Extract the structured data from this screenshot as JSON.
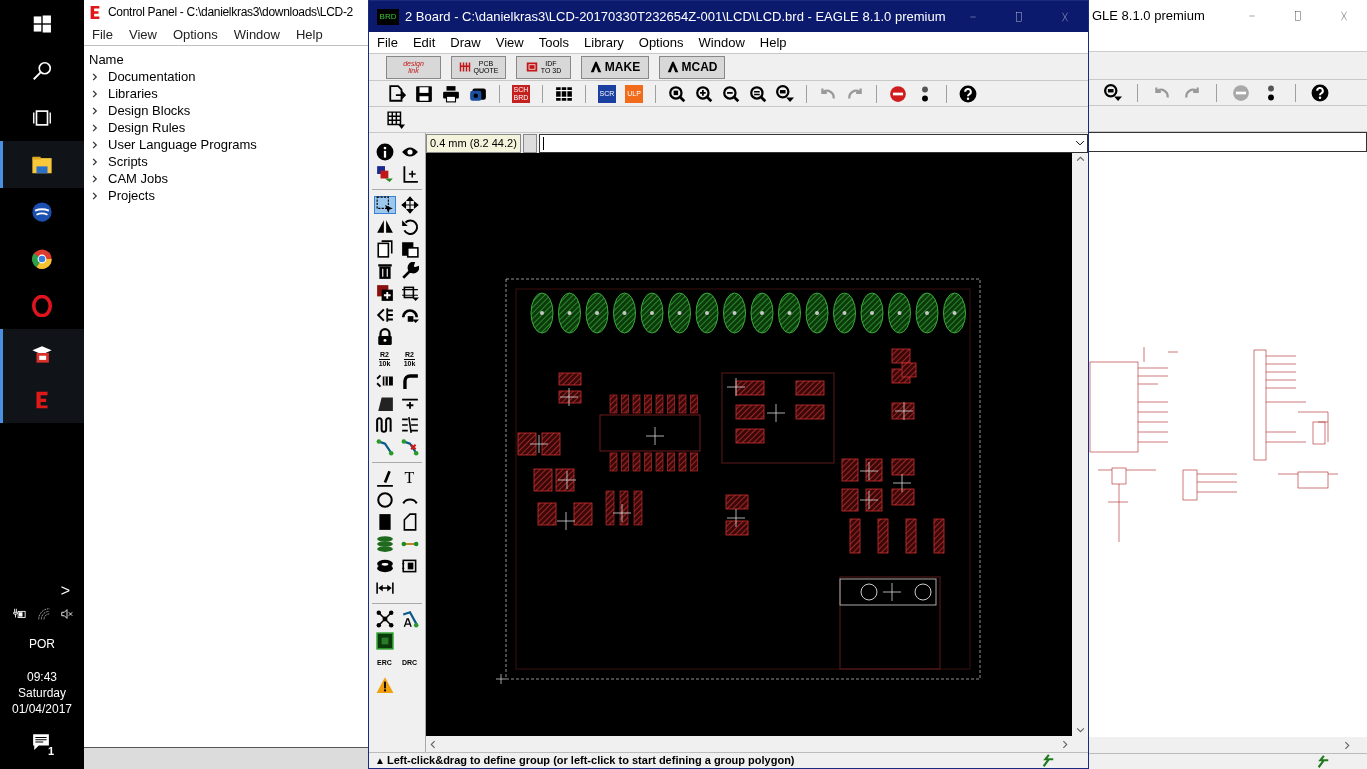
{
  "taskbar": {
    "buttons": [
      {
        "kind": "start",
        "active": false
      },
      {
        "kind": "search",
        "active": false
      },
      {
        "kind": "task-view",
        "active": false
      },
      {
        "kind": "folder",
        "active": true
      },
      {
        "kind": "bird",
        "active": false
      },
      {
        "kind": "browser-ring",
        "active": false
      },
      {
        "kind": "letter-o",
        "active": false
      },
      {
        "kind": "cap",
        "active": true
      },
      {
        "kind": "letter-e",
        "active": true
      }
    ],
    "tray_caret": ">",
    "language": "POR",
    "time": "09:43",
    "day": "Saturday",
    "date": "01/04/2017",
    "notifications": "1"
  },
  "control_panel": {
    "title": "Control Panel - C:\\danielkras3\\downloads\\LCD-2",
    "menu": [
      "File",
      "View",
      "Options",
      "Window",
      "Help"
    ],
    "column": "Name",
    "items": [
      {
        "label": "Documentation",
        "expanded": false
      },
      {
        "label": "Libraries",
        "expanded": false
      },
      {
        "label": "Design Blocks",
        "expanded": false
      },
      {
        "label": "Design Rules",
        "expanded": false
      },
      {
        "label": "User Language Programs",
        "expanded": false
      },
      {
        "label": "Scripts",
        "expanded": false
      },
      {
        "label": "CAM Jobs",
        "expanded": false
      },
      {
        "label": "Projects",
        "expanded": false
      }
    ]
  },
  "board_window": {
    "badge": "BRD",
    "title": "2 Board - C:\\danielkras3\\LCD-20170330T232654Z-001\\LCD\\LCD.brd - EAGLE 8.1.0 premium",
    "menu": [
      "File",
      "Edit",
      "Draw",
      "View",
      "Tools",
      "Library",
      "Options",
      "Window",
      "Help"
    ],
    "service_buttons": [
      {
        "kind": "designlink",
        "lines": [
          "design",
          "link"
        ]
      },
      {
        "kind": "pcb-quote",
        "lines": [
          "PCB",
          "QUOTE"
        ]
      },
      {
        "kind": "idf",
        "lines": [
          "IDF",
          "TO 3D"
        ]
      },
      {
        "kind": "make",
        "lines": [
          "MAKE"
        ]
      },
      {
        "kind": "mcad",
        "lines": [
          "MCAD"
        ]
      }
    ],
    "toolbar": [
      {
        "kind": "open",
        "disabled": false
      },
      {
        "kind": "save",
        "disabled": false
      },
      {
        "kind": "print",
        "disabled": false
      },
      {
        "kind": "cam",
        "disabled": false
      },
      {
        "kind": "sep"
      },
      {
        "kind": "switch",
        "label": "SCH BRD",
        "disabled": false
      },
      {
        "kind": "sep"
      },
      {
        "kind": "library",
        "disabled": false
      },
      {
        "kind": "sep"
      },
      {
        "kind": "script",
        "label": "SCR",
        "disabled": false
      },
      {
        "kind": "ulp",
        "label": "ULP",
        "disabled": false
      },
      {
        "kind": "sep"
      },
      {
        "kind": "zoom-fit",
        "disabled": false
      },
      {
        "kind": "zoom-in",
        "disabled": false
      },
      {
        "kind": "zoom-out",
        "disabled": false
      },
      {
        "kind": "zoom-redraw",
        "disabled": false
      },
      {
        "kind": "zoom-select",
        "disabled": false
      },
      {
        "kind": "sep"
      },
      {
        "kind": "undo",
        "disabled": true
      },
      {
        "kind": "redo",
        "disabled": true
      },
      {
        "kind": "sep"
      },
      {
        "kind": "stop",
        "disabled": false
      },
      {
        "kind": "go",
        "disabled": false
      },
      {
        "kind": "sep"
      },
      {
        "kind": "help",
        "disabled": false
      }
    ],
    "coordinates": "0.4 mm (8.2 44.2)",
    "tools": [
      {
        "kind": "info",
        "selected": false
      },
      {
        "kind": "eye",
        "selected": false
      },
      {
        "kind": "layers",
        "selected": false
      },
      {
        "kind": "mark",
        "selected": false
      },
      {
        "kind": "sep"
      },
      {
        "kind": "group",
        "selected": true
      },
      {
        "kind": "move",
        "selected": false
      },
      {
        "kind": "mirror",
        "selected": false
      },
      {
        "kind": "rotate",
        "selected": false
      },
      {
        "kind": "copy",
        "selected": false
      },
      {
        "kind": "paste",
        "selected": false
      },
      {
        "kind": "delete",
        "selected": false
      },
      {
        "kind": "wrench",
        "selected": false
      },
      {
        "kind": "add",
        "selected": false
      },
      {
        "kind": "replace",
        "selected": false
      },
      {
        "kind": "swap",
        "selected": false
      },
      {
        "kind": "lock-rotate",
        "selected": false
      },
      {
        "kind": "lock",
        "selected": false
      },
      {
        "kind": "blank"
      },
      {
        "kind": "name",
        "label": "R2",
        "sub": "10k",
        "selected": false
      },
      {
        "kind": "value",
        "label": "R2",
        "sub": "10k",
        "selected": false
      },
      {
        "kind": "split",
        "selected": false
      },
      {
        "kind": "miter",
        "selected": false
      },
      {
        "kind": "slope",
        "selected": false
      },
      {
        "kind": "optimize",
        "selected": false
      },
      {
        "kind": "meander",
        "selected": false
      },
      {
        "kind": "lines",
        "selected": false
      },
      {
        "kind": "route",
        "selected": false
      },
      {
        "kind": "ripup",
        "selected": false
      },
      {
        "kind": "sep"
      },
      {
        "kind": "wire",
        "selected": false
      },
      {
        "kind": "text",
        "label": "T",
        "selected": false
      },
      {
        "kind": "circle",
        "selected": false
      },
      {
        "kind": "arc",
        "selected": false
      },
      {
        "kind": "rect",
        "selected": false
      },
      {
        "kind": "polygon",
        "selected": false
      },
      {
        "kind": "via",
        "selected": false
      },
      {
        "kind": "signal",
        "selected": false
      },
      {
        "kind": "hole",
        "selected": false
      },
      {
        "kind": "attribute",
        "selected": false
      },
      {
        "kind": "dimension",
        "selected": false
      },
      {
        "kind": "blank"
      },
      {
        "kind": "sep"
      },
      {
        "kind": "autorouter",
        "selected": false
      },
      {
        "kind": "route-a",
        "selected": false
      },
      {
        "kind": "chip",
        "selected": false
      },
      {
        "kind": "blank"
      },
      {
        "kind": "erc",
        "label": "ERC",
        "selected": false
      },
      {
        "kind": "drc",
        "label": "DRC",
        "selected": false
      },
      {
        "kind": "warning",
        "selected": false
      }
    ],
    "status_icon": "▲",
    "status": "Left-click&drag to define group (or left-click to start defining a group polygon)"
  },
  "schematic_window": {
    "title": "GLE 8.1.0 premium",
    "toolbar": [
      {
        "kind": "zoom-select",
        "disabled": false
      },
      {
        "kind": "sep"
      },
      {
        "kind": "undo",
        "disabled": true
      },
      {
        "kind": "redo",
        "disabled": true
      },
      {
        "kind": "sep"
      },
      {
        "kind": "stop",
        "disabled": true
      },
      {
        "kind": "go",
        "disabled": false
      },
      {
        "kind": "sep"
      },
      {
        "kind": "help",
        "disabled": false
      }
    ]
  }
}
